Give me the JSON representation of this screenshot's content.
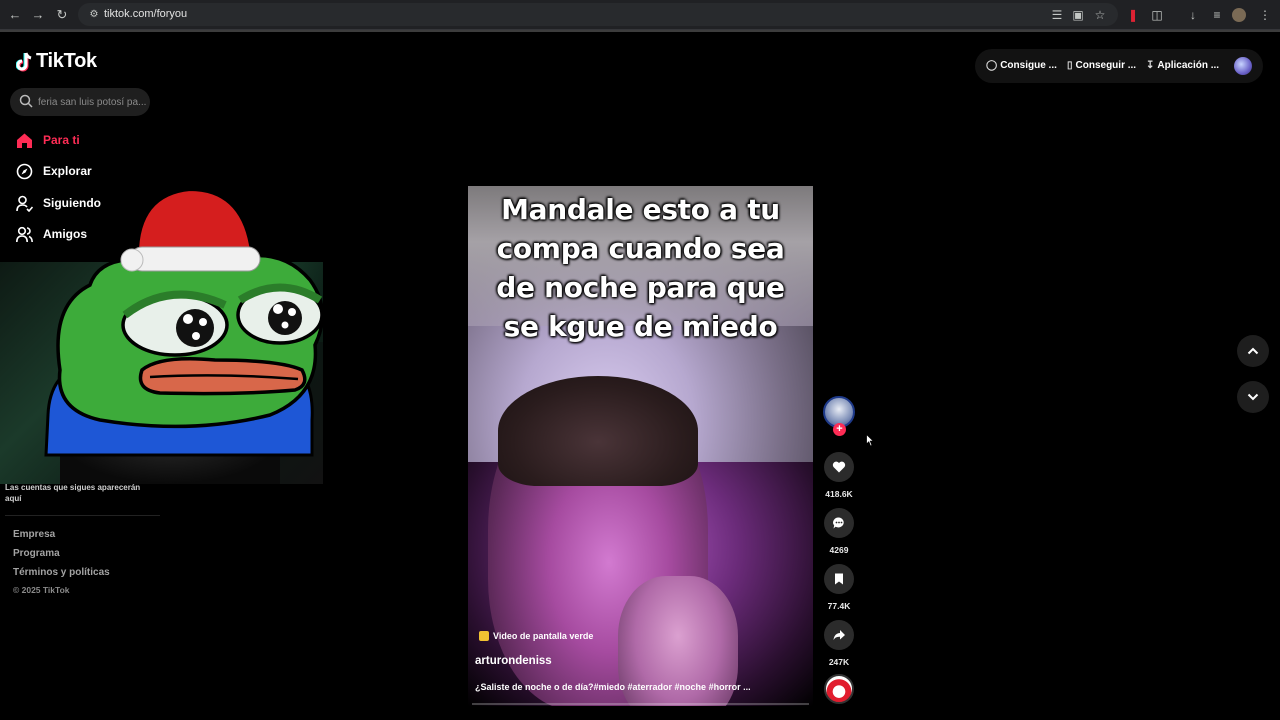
{
  "browser": {
    "url": "tiktok.com/foryou",
    "nav_icons": [
      "back-icon",
      "forward-icon",
      "reload-icon",
      "site-info-icon"
    ],
    "toolbar_icons": [
      "translate-icon",
      "cast-icon",
      "bookmark-star-icon",
      "extension-icon",
      "extensions-puzzle-icon",
      "download-icon",
      "reading-list-icon",
      "profile-icon",
      "menu-kebab-icon"
    ]
  },
  "sidebar": {
    "logo": "TikTok",
    "search_placeholder": "feria san luis potosí pa...",
    "items": [
      {
        "label": "Para ti",
        "icon": "home-icon",
        "active": true
      },
      {
        "label": "Explorar",
        "icon": "compass-icon",
        "active": false
      },
      {
        "label": "Siguiendo",
        "icon": "following-icon",
        "active": false
      },
      {
        "label": "Amigos",
        "icon": "friends-icon",
        "active": false
      }
    ],
    "following_note": "Las cuentas que sigues aparecerán aquí",
    "footer_links": [
      "Empresa",
      "Programa",
      "Términos y políticas"
    ],
    "copyright": "© 2025 TikTok"
  },
  "topbar": {
    "items": [
      {
        "label": "Consigue ...",
        "icon": "coin-icon"
      },
      {
        "label": "Conseguir ...",
        "icon": "phone-icon"
      },
      {
        "label": "Aplicación ...",
        "icon": "download-icon"
      }
    ],
    "profile_icon": "avatar"
  },
  "video": {
    "caption_lines": [
      "Mandale esto a tu",
      "compa cuando sea",
      "de noche para que",
      "se kgue de miedo"
    ],
    "badge": "Video de pantalla verde",
    "author": "arturondeniss",
    "description": "¿Saliste de noche o de día?#miedo #aterrador #noche #horror ...",
    "progress": 0.0
  },
  "actions": {
    "likes": "418.6K",
    "comments": "4269",
    "saves": "77.4K",
    "shares": "247K"
  },
  "colors": {
    "accent": "#fe2c55",
    "background": "#000000",
    "action_bg": "#2b2b2b"
  }
}
